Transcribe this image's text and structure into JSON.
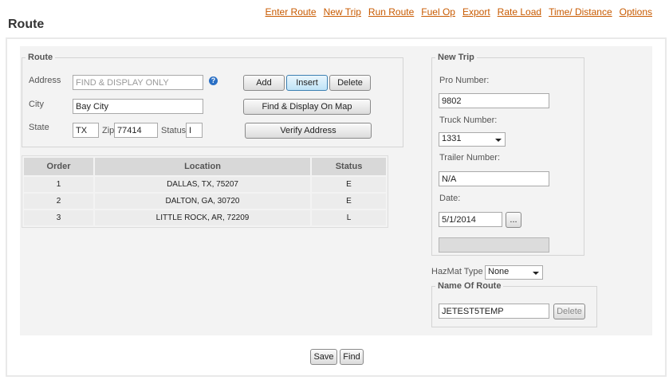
{
  "nav": {
    "links": [
      "Enter Route",
      "New Trip",
      "Run Route",
      "Fuel Op",
      "Export",
      "Rate Load",
      "Time/ Distance",
      "Options"
    ]
  },
  "page": {
    "title": "Route"
  },
  "route": {
    "legend": "Route",
    "address_label": "Address",
    "address_value": "FIND & DISPLAY ONLY",
    "help_icon": "question-circle-icon",
    "city_label": "City",
    "city_value": "Bay City",
    "state_label": "State",
    "state_value": "TX",
    "zip_label": "Zip",
    "zip_value": "77414",
    "status_label": "Status",
    "status_value": "I",
    "add_label": "Add",
    "insert_label": "Insert",
    "delete_label": "Delete",
    "find_display_label": "Find & Display On Map",
    "verify_label": "Verify Address"
  },
  "table": {
    "headers": [
      "Order",
      "Location",
      "Status"
    ],
    "rows": [
      [
        "1",
        "DALLAS, TX, 75207",
        "E"
      ],
      [
        "2",
        "DALTON, GA, 30720",
        "E"
      ],
      [
        "3",
        "LITTLE ROCK, AR, 72209",
        "L"
      ]
    ]
  },
  "trip": {
    "legend": "New Trip",
    "pro_label": "Pro Number:",
    "pro_value": "9802",
    "truck_label": "Truck Number:",
    "truck_value": "1331",
    "trailer_label": "Trailer Number:",
    "trailer_value": "N/A",
    "date_label": "Date:",
    "date_value": "5/1/2014",
    "date_button": "..."
  },
  "hazmat": {
    "label": "HazMat Type",
    "value": "None"
  },
  "name_of_route": {
    "legend": "Name Of Route",
    "value": "JETEST5TEMP",
    "delete_label": "Delete"
  },
  "footer": {
    "save_label": "Save",
    "find_label": "Find"
  },
  "colors": {
    "nav_link": "#c85a00",
    "active_button": "#bfe3f7",
    "help_icon": "#2a6fc4"
  }
}
